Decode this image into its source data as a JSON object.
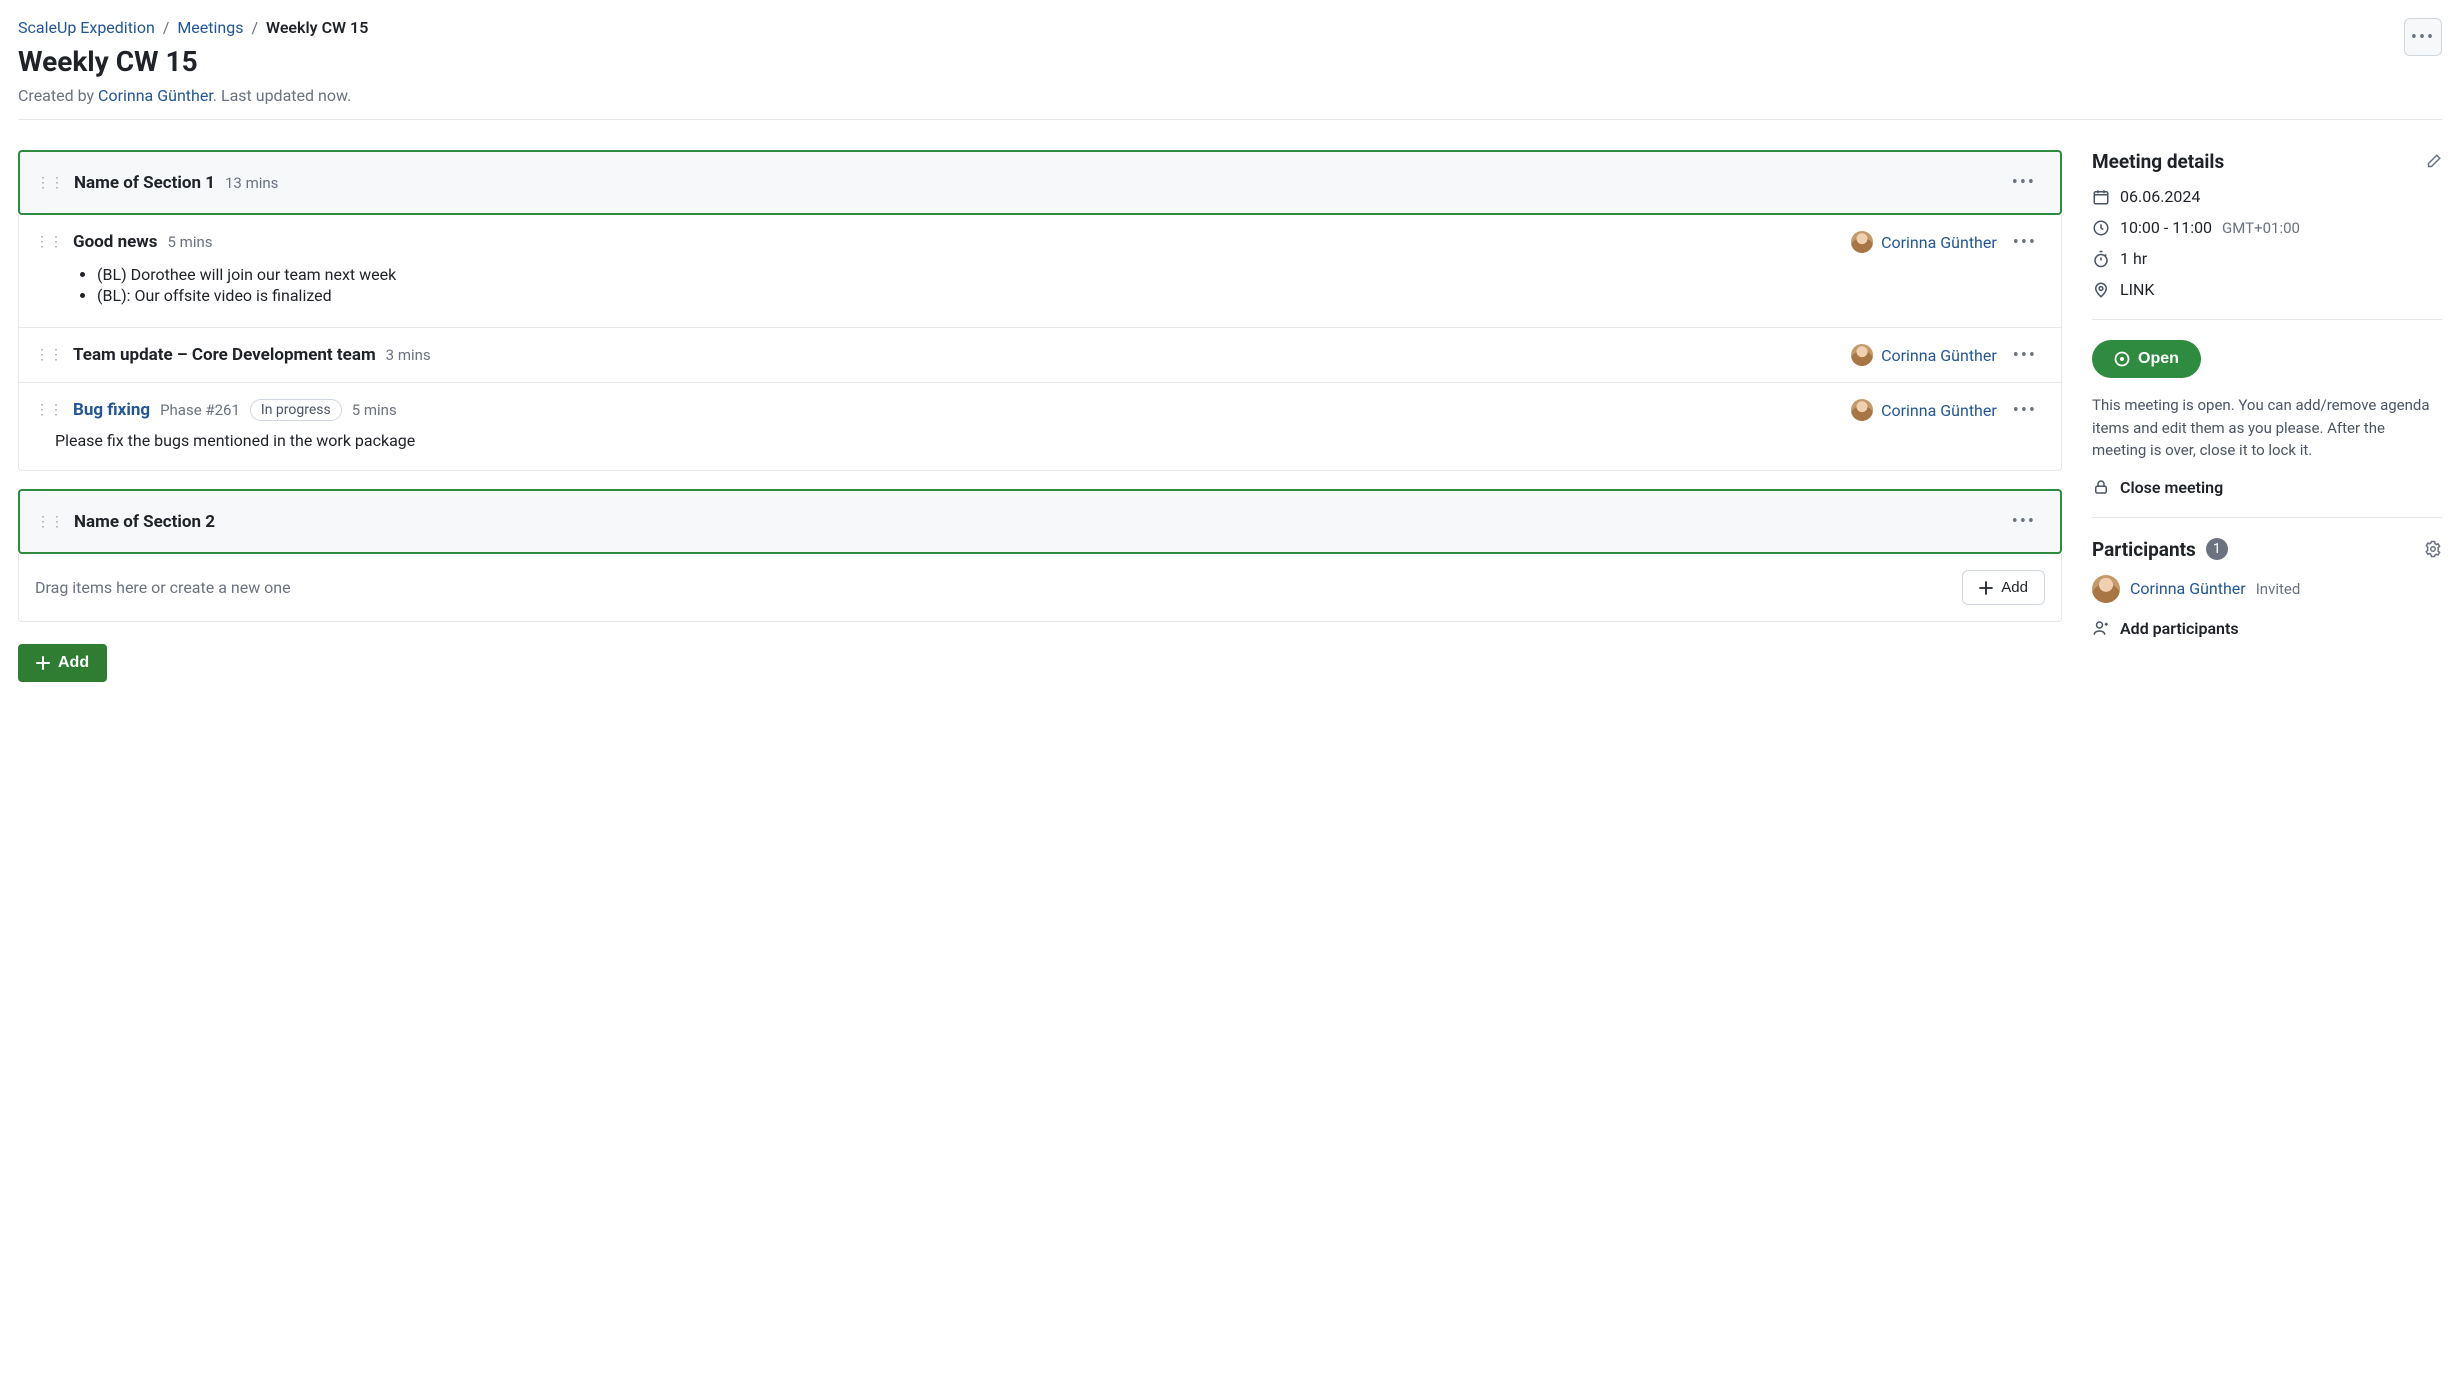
{
  "breadcrumb": {
    "project": "ScaleUp Expedition",
    "section": "Meetings",
    "current": "Weekly CW 15"
  },
  "page_title": "Weekly CW 15",
  "meta": {
    "created_by_label": "Created by ",
    "author": "Corinna Günther",
    "updated": "Last updated now."
  },
  "sections": [
    {
      "title": "Name of Section 1",
      "duration": "13 mins",
      "items": [
        {
          "title": "Good news",
          "duration": "5 mins",
          "owner": "Corinna Günther",
          "bullets": [
            "(BL) Dorothee will join our team next week",
            "(BL): Our offsite video is finalized"
          ]
        },
        {
          "title": "Team update – Core Development team",
          "duration": "3 mins",
          "owner": "Corinna Günther"
        },
        {
          "title": "Bug fixing",
          "title_link": true,
          "phase": "Phase #261",
          "status": "In progress",
          "duration": "5 mins",
          "owner": "Corinna Günther",
          "body_text": "Please fix the bugs mentioned in the work package"
        }
      ]
    },
    {
      "title": "Name of Section 2",
      "dropzone": "Drag items here or create a new one",
      "add_label": "Add"
    }
  ],
  "add_button": "Add",
  "sidebar": {
    "details_heading": "Meeting details",
    "date": "06.06.2024",
    "time": "10:00 - 11:00",
    "tz": "GMT+01:00",
    "duration": "1 hr",
    "location": "LINK",
    "open_label": "Open",
    "open_desc": "This meeting is open. You can add/remove agenda items and edit them as you please. After the meeting is over, close it to lock it.",
    "close_label": "Close meeting",
    "participants_heading": "Participants",
    "participants_count": "1",
    "participants": [
      {
        "name": "Corinna Günther",
        "status": "Invited"
      }
    ],
    "add_participants": "Add participants"
  }
}
